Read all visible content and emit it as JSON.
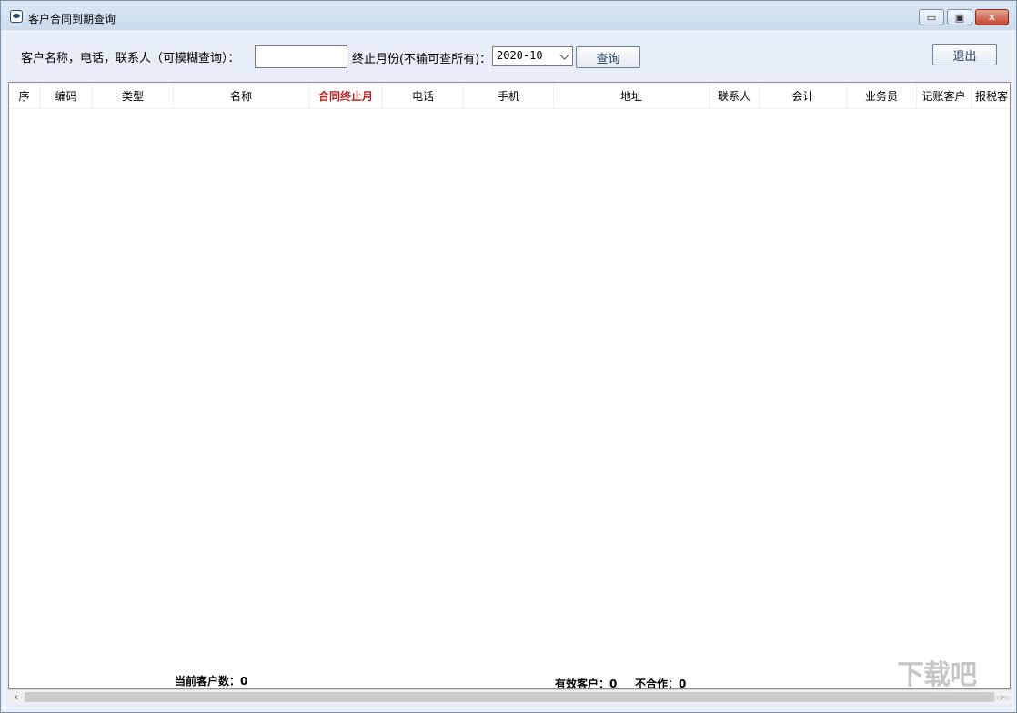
{
  "window": {
    "title": "客户合同到期查询",
    "controls": {
      "minimize": "▭",
      "maximize": "▣",
      "close": "✕"
    }
  },
  "search": {
    "name_label": "客户名称，电话，联系人（可模糊查询）：",
    "name_value": "",
    "month_label": "终止月份(不输可查所有)：",
    "month_value": "2020-10",
    "query_button": "查询",
    "exit_button": "退出"
  },
  "table": {
    "columns": [
      "序",
      "编码",
      "类型",
      "名称",
      "合同终止月",
      "电话",
      "手机",
      "地址",
      "联系人",
      "会计",
      "业务员",
      "记账客户",
      "报税客"
    ],
    "highlight_column": "合同终止月",
    "rows": []
  },
  "footer": {
    "current_count": "当前客户数：0",
    "valid_count": "有效客户：0",
    "inactive_count": "不合作：0"
  },
  "scrollbar": {
    "left_arrow": "‹",
    "right_arrow": "›"
  },
  "watermark": {
    "text": "下载吧",
    "url": "www.xiazaiba.com"
  },
  "colors": {
    "highlight": "#b22222",
    "window_bg": "#e7eef7"
  }
}
